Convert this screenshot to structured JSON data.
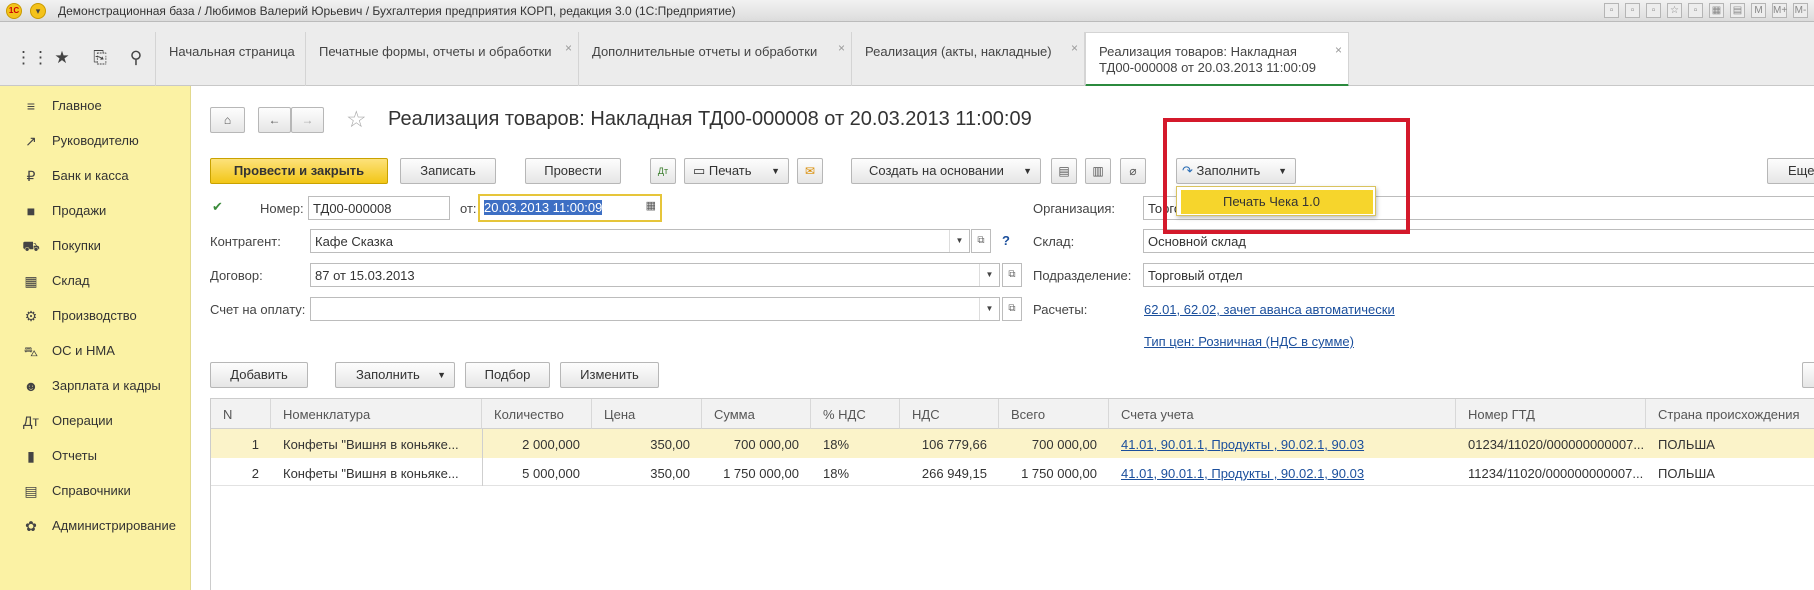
{
  "titlebar": {
    "text": "Демонстрационная база / Любимов Валерий Юрьевич / Бухгалтерия предприятия КОРП, редакция 3.0  (1С:Предприятие)",
    "logo": "1С",
    "right_labels": [
      "M",
      "M+",
      "M-"
    ]
  },
  "tabs": [
    {
      "label": "Начальная страница"
    },
    {
      "label": "Печатные формы, отчеты и обработки"
    },
    {
      "label": "Дополнительные отчеты и обработки"
    },
    {
      "label": "Реализация (акты, накладные)"
    },
    {
      "label_line1": "Реализация товаров: Накладная",
      "label_line2": "ТД00-000008 от 20.03.2013 11:00:09"
    }
  ],
  "sidebar": {
    "items": [
      {
        "label": "Главное",
        "icon": "menu-icon"
      },
      {
        "label": "Руководителю",
        "icon": "trend-icon"
      },
      {
        "label": "Банк и касса",
        "icon": "coin-icon"
      },
      {
        "label": "Продажи",
        "icon": "bag-icon"
      },
      {
        "label": "Покупки",
        "icon": "cart-icon"
      },
      {
        "label": "Склад",
        "icon": "grid-icon"
      },
      {
        "label": "Производство",
        "icon": "factory-icon"
      },
      {
        "label": "ОС и НМА",
        "icon": "truck-icon"
      },
      {
        "label": "Зарплата и кадры",
        "icon": "people-icon"
      },
      {
        "label": "Операции",
        "icon": "operations-icon"
      },
      {
        "label": "Отчеты",
        "icon": "chart-icon"
      },
      {
        "label": "Справочники",
        "icon": "book-icon"
      },
      {
        "label": "Администрирование",
        "icon": "gear-icon"
      }
    ]
  },
  "doc": {
    "title": "Реализация товаров: Накладная ТД00-000008 от 20.03.2013 11:00:09",
    "toolbar": {
      "post_close": "Провести и закрыть",
      "save": "Записать",
      "post": "Провести",
      "print": "Печать",
      "create_based": "Создать на основании",
      "fill": "Заполнить",
      "more": "Еще"
    },
    "popup_item": "Печать Чека 1.0",
    "number_label": "Номер:",
    "number_value": "ТД00-000008",
    "date_label": "от:",
    "date_value": "20.03.2013 11:00:09",
    "org_label": "Организация:",
    "org_value": "Торговый дом",
    "contractor_label": "Контрагент:",
    "contractor_value": "Кафе Сказка",
    "help": "?",
    "warehouse_label": "Склад:",
    "warehouse_value": "Основной склад",
    "contract_label": "Договор:",
    "contract_value": "87 от 15.03.2013",
    "division_label": "Подразделение:",
    "division_value": "Торговый отдел",
    "invoice_label": "Счет на оплату:",
    "invoice_value": "",
    "payments_label": "Расчеты:",
    "payments_link": "62.01, 62.02, зачет аванса автоматически",
    "price_type_link": "Тип цен: Розничная (НДС в сумме)"
  },
  "table_toolbar": {
    "add": "Добавить",
    "fill": "Заполнить",
    "pick": "Подбор",
    "change": "Изменить"
  },
  "table": {
    "headers": [
      "N",
      "Номенклатура",
      "Количество",
      "Цена",
      "Сумма",
      "% НДС",
      "НДС",
      "Всего",
      "Счета учета",
      "Номер ГТД",
      "Страна происхождения"
    ],
    "rows": [
      [
        "1",
        "Конфеты \"Вишня в коньяке...",
        "2 000,000",
        "350,00",
        "700 000,00",
        "18%",
        "106 779,66",
        "700 000,00",
        "41.01, 90.01.1, Продукты , 90.02.1, 90.03",
        "01234/11020/000000000007...",
        "ПОЛЬША"
      ],
      [
        "2",
        "Конфеты \"Вишня в коньяке...",
        "5 000,000",
        "350,00",
        "1 750 000,00",
        "18%",
        "266 949,15",
        "1 750 000,00",
        "41.01, 90.01.1, Продукты , 90.02.1, 90.03",
        "11234/11020/000000000007...",
        "ПОЛЬША"
      ]
    ]
  },
  "colors": {
    "accent_yellow": "#f6d52c",
    "sidebar_bg": "#fbf2a4",
    "highlight_red": "#d4192b",
    "link": "#1b4f9c"
  }
}
